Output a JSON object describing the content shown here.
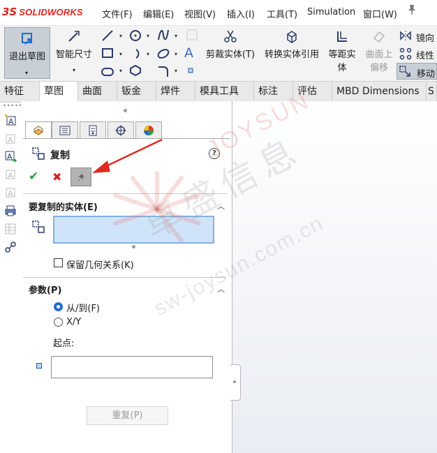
{
  "app": {
    "logo_mark": "3S",
    "logo_text": "SOLIDWORKS",
    "brand_color": "#e2231a"
  },
  "menu": {
    "items": [
      "文件(F)",
      "编辑(E)",
      "视图(V)",
      "插入(I)",
      "工具(T)",
      "Simulation",
      "窗口(W)"
    ],
    "pin_icon": "pushpin-icon"
  },
  "command_manager": {
    "exit_sketch": "退出草图",
    "smart_dimension": "智能尺寸",
    "trim_entities": "剪裁实体(T)",
    "convert_entities": "转换实体引用",
    "offset_entities_line1": "等距实",
    "offset_entities_line2": "体",
    "offset_on_surface_line1": "曲面上",
    "offset_on_surface_line2": "偏移",
    "mirror": "镜向",
    "linear": "线性",
    "move": "移动"
  },
  "tabs": [
    "特征",
    "草图",
    "曲面",
    "钣金",
    "焊件",
    "模具工具",
    "标注",
    "评估",
    "MBD Dimensions",
    "S"
  ],
  "active_tab": "草图",
  "property_manager": {
    "title": "复制",
    "help_icon": "help-icon",
    "ok_icon": "check-icon",
    "cancel_icon": "close-icon",
    "pin_icon": "pushpin-icon",
    "group_entities": {
      "title": "要复制的实体(E)",
      "checkbox_label": "保留几何关系(K)",
      "checkbox_checked": false
    },
    "group_params": {
      "title": "参数(P)",
      "option_fromto": "从/到(F)",
      "option_xy": "X/Y",
      "selected": "从/到(F)",
      "start_label": "起点:",
      "redo_label": "重复(P)"
    }
  },
  "watermark": {
    "brand": "JOYSUN",
    "chinese": "卓盛信息",
    "url": "sw-joysun.com.cn"
  }
}
